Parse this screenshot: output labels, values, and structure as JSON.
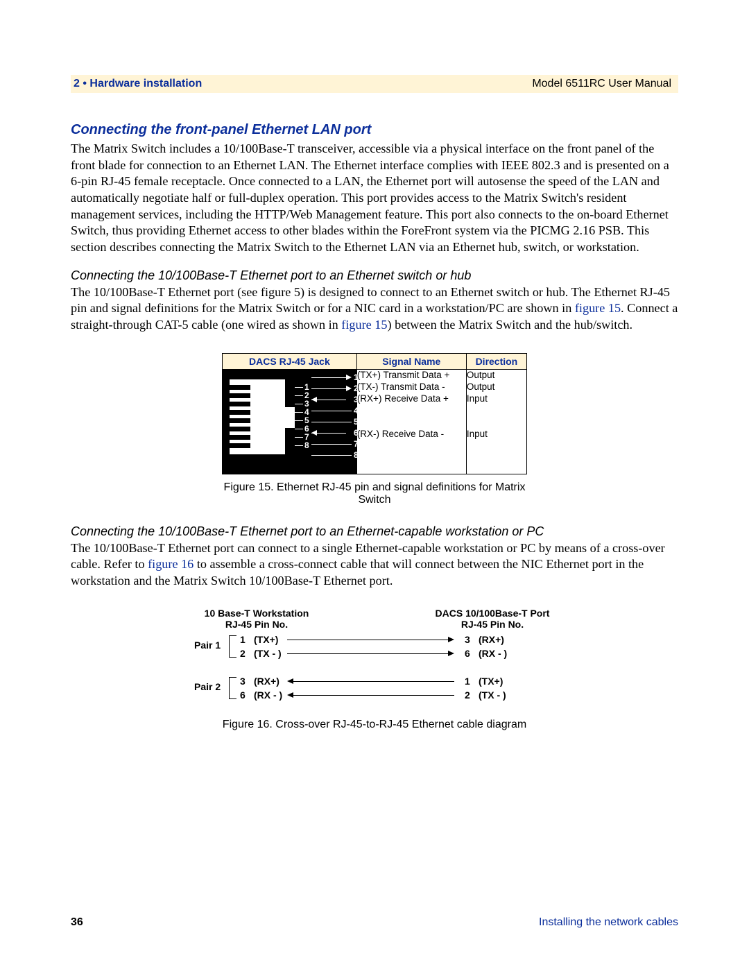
{
  "header": {
    "chapter": "2 • Hardware installation",
    "manual": "Model 6511RC User Manual"
  },
  "h2": "Connecting the front-panel Ethernet LAN port",
  "p1": "The Matrix Switch includes a 10/100Base-T transceiver, accessible via a physical interface on the front panel of the front blade for connection to an Ethernet LAN. The Ethernet interface complies with IEEE 802.3 and is presented on a 6-pin RJ-45 female receptacle. Once connected to a LAN, the Ethernet port will autosense the speed of the LAN and automatically negotiate half or full-duplex operation. This port provides access to the Matrix Switch's resident management services, including the HTTP/Web Management feature. This port also connects to the on-board Ethernet Switch, thus providing Ethernet access to other blades within the ForeFront system via the PICMG 2.16 PSB. This section describes connecting the Matrix Switch to the Ethernet LAN via an Ethernet hub, switch, or workstation.",
  "h3a": "Connecting the 10/100Base-T Ethernet port to an Ethernet switch or hub",
  "p2a": "The 10/100Base-T Ethernet port (see figure 5) is designed to connect to an Ethernet switch or hub. The Ethernet RJ-45 pin and signal definitions for the Matrix Switch or for a NIC card in a workstation/PC are shown in ",
  "p2_link1": "figure 15",
  "p2b": ". Connect a straight-through CAT-5 cable (one wired as shown in ",
  "p2_link2": "figure 15",
  "p2c": ") between the Matrix Switch and the hub/switch.",
  "fig15": {
    "th1": "DACS RJ-45 Jack",
    "th2": "Signal Name",
    "th3": "Direction",
    "signals": {
      "s1": "(TX+) Transmit Data +",
      "s2": "(TX-) Transmit Data -",
      "s3": "(RX+) Receive Data +",
      "s6": "(RX-) Receive Data -"
    },
    "dirs": {
      "d1": "Output",
      "d2": "Output",
      "d3": "Input",
      "d6": "Input"
    },
    "pins": {
      "p1": "1",
      "p2": "2",
      "p3": "3",
      "p4": "4",
      "p5": "5",
      "p6": "6",
      "p7": "7",
      "p8": "8"
    },
    "caption": "Figure 15. Ethernet RJ-45 pin and signal definitions for Matrix Switch"
  },
  "h3b": "Connecting the 10/100Base-T Ethernet port to an Ethernet-capable workstation or PC",
  "p3a": "The 10/100Base-T Ethernet port can connect to a single Ethernet-capable workstation or PC by means of a cross-over cable. Refer to ",
  "p3_link": "figure 16",
  "p3b": " to assemble a cross-connect cable that will connect between the NIC Ethernet port in the workstation and the Matrix Switch 10/100Base-T Ethernet port.",
  "fig16": {
    "hdr_l1": "10 Base-T Workstation",
    "hdr_l2": "RJ-45 Pin No.",
    "hdr_r1": "DACS 10/100Base-T Port",
    "hdr_r2": "RJ-45 Pin No.",
    "pair1": "Pair 1",
    "pair2": "Pair 2",
    "rows": {
      "r1": {
        "lp": "1",
        "ls": "(TX+)",
        "rp": "3",
        "rs": "(RX+)"
      },
      "r2": {
        "lp": "2",
        "ls": "(TX - )",
        "rp": "6",
        "rs": "(RX - )"
      },
      "r3": {
        "lp": "3",
        "ls": "(RX+)",
        "rp": "1",
        "rs": "(TX+)"
      },
      "r4": {
        "lp": "6",
        "ls": "(RX - )",
        "rp": "2",
        "rs": "(TX - )"
      }
    },
    "caption": "Figure 16. Cross-over RJ-45-to-RJ-45 Ethernet cable diagram"
  },
  "footer": {
    "page": "36",
    "section": "Installing the network cables"
  }
}
